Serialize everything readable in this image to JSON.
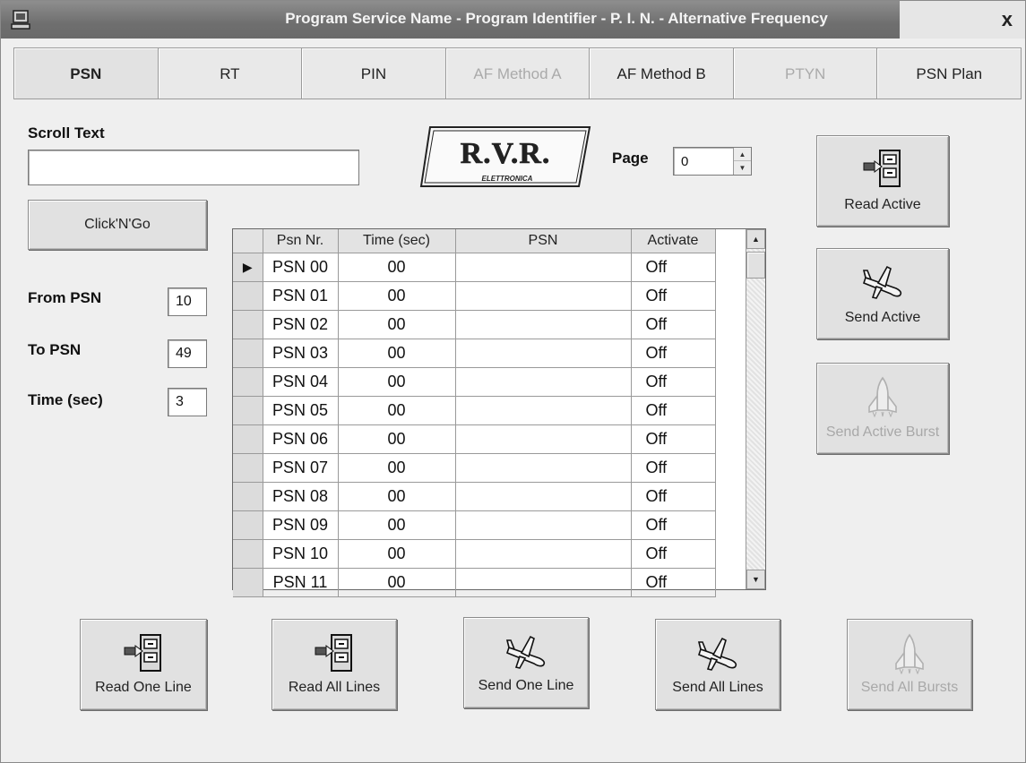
{
  "window": {
    "title": "Program Service Name - Program Identifier - P. I. N. - Alternative Frequency",
    "close_glyph": "x"
  },
  "tabs": [
    {
      "label": "PSN",
      "state": "active"
    },
    {
      "label": "RT",
      "state": "normal"
    },
    {
      "label": "PIN",
      "state": "normal"
    },
    {
      "label": "AF Method A",
      "state": "disabled"
    },
    {
      "label": "AF Method B",
      "state": "normal"
    },
    {
      "label": "PTYN",
      "state": "disabled"
    },
    {
      "label": "PSN Plan",
      "state": "normal"
    }
  ],
  "scroll": {
    "label": "Scroll Text",
    "value": "",
    "button": "Click'N'Go"
  },
  "logo": {
    "text": "R.V.R.",
    "subtext": "ELETTRONICA"
  },
  "page": {
    "label": "Page",
    "value": "0"
  },
  "range": {
    "from_label": "From PSN",
    "from_value": "10",
    "to_label": "To PSN",
    "to_value": "49",
    "time_label": "Time (sec)",
    "time_value": "3"
  },
  "side_buttons": {
    "read_active": "Read Active",
    "send_active": "Send Active",
    "send_active_burst": "Send Active Burst"
  },
  "grid": {
    "headers": [
      "Psn Nr.",
      "Time (sec)",
      "PSN",
      "Activate"
    ],
    "current_row_marker": "▶",
    "rows": [
      {
        "nr": "PSN 00",
        "time": "00",
        "psn": "",
        "activate": "Off"
      },
      {
        "nr": "PSN 01",
        "time": "00",
        "psn": "",
        "activate": "Off"
      },
      {
        "nr": "PSN 02",
        "time": "00",
        "psn": "",
        "activate": "Off"
      },
      {
        "nr": "PSN 03",
        "time": "00",
        "psn": "",
        "activate": "Off"
      },
      {
        "nr": "PSN 04",
        "time": "00",
        "psn": "",
        "activate": "Off"
      },
      {
        "nr": "PSN 05",
        "time": "00",
        "psn": "",
        "activate": "Off"
      },
      {
        "nr": "PSN 06",
        "time": "00",
        "psn": "",
        "activate": "Off"
      },
      {
        "nr": "PSN 07",
        "time": "00",
        "psn": "",
        "activate": "Off"
      },
      {
        "nr": "PSN 08",
        "time": "00",
        "psn": "",
        "activate": "Off"
      },
      {
        "nr": "PSN 09",
        "time": "00",
        "psn": "",
        "activate": "Off"
      },
      {
        "nr": "PSN 10",
        "time": "00",
        "psn": "",
        "activate": "Off"
      },
      {
        "nr": "PSN 11",
        "time": "00",
        "psn": "",
        "activate": "Off"
      }
    ]
  },
  "bottom_buttons": {
    "read_one_line": "Read One Line",
    "read_all_lines": "Read All Lines",
    "send_one_line": "Send One Line",
    "send_all_lines": "Send All Lines",
    "send_all_bursts": "Send All Bursts"
  },
  "icons": {
    "app": "computer-icon",
    "read": "file-cabinet-icon",
    "send": "airplane-icon",
    "burst": "space-shuttle-icon"
  }
}
